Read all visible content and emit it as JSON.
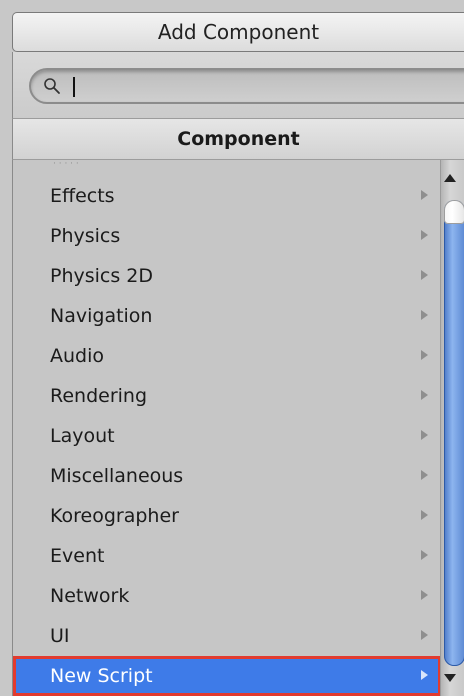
{
  "window": {
    "title": "Add Component"
  },
  "search": {
    "value": "",
    "placeholder": "",
    "icon": "search-icon"
  },
  "section": {
    "title": "Component"
  },
  "menu": {
    "items": [
      {
        "label": "Effects",
        "has_submenu": true
      },
      {
        "label": "Physics",
        "has_submenu": true
      },
      {
        "label": "Physics 2D",
        "has_submenu": true
      },
      {
        "label": "Navigation",
        "has_submenu": true
      },
      {
        "label": "Audio",
        "has_submenu": true
      },
      {
        "label": "Rendering",
        "has_submenu": true
      },
      {
        "label": "Layout",
        "has_submenu": true
      },
      {
        "label": "Miscellaneous",
        "has_submenu": true
      },
      {
        "label": "Koreographer",
        "has_submenu": true
      },
      {
        "label": "Event",
        "has_submenu": true
      },
      {
        "label": "Network",
        "has_submenu": true
      },
      {
        "label": "UI",
        "has_submenu": true
      },
      {
        "label": "New Script",
        "has_submenu": true,
        "selected": true
      }
    ]
  },
  "colors": {
    "selection": "#3e7be8",
    "highlight_outline": "#e23b2f",
    "scroll_thumb": "#6f9be0"
  }
}
